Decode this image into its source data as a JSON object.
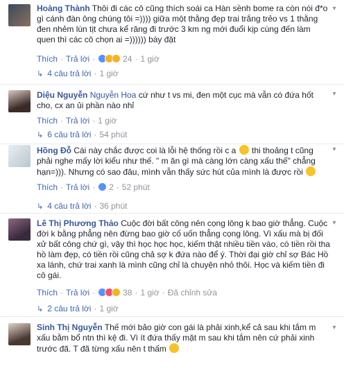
{
  "comments": [
    {
      "name": "Hoàng Thành",
      "text": " Thôi đi các cô cũng thích soái ca Hàn sềnh bome ra còn nói đ*o gì cánh đàn ông chúng tôi =)))) giữa một thằng đẹp trai trắng trẻo vs 1 thằng đen nhẻm lùn tịt chưa kể răng đi trước 3 km ng mới đuổi kịp cùng đến làm quen thì các cô chọn ai =)))))) bày đặt",
      "like": "Thích",
      "reply": "Trả lời",
      "reactions": "24",
      "time": "1 giờ",
      "reply_arrow": "↳",
      "replies_label": "4 câu trả lời",
      "replies_time": "1 giờ"
    },
    {
      "name": "Diệu Nguyễn",
      "tag": "Nguyễn Hoa",
      "text": " cứ như t vs mi, đen một cục mà vẫn có đứa hốt cho, cx an ủi phần nào nhỉ",
      "like": "Thích",
      "reply": "Trả lời",
      "time": "1 giờ",
      "reply_arrow": "↳",
      "replies_label": "6 câu trả lời",
      "replies_time": "54 phút"
    },
    {
      "name": "Hồng Đỗ",
      "text_1": " Cái này chắc được coi là lỗi hệ thống rồi c a ",
      "text_2": " thi thoảng t cũng phải nghe mấy lời kiểu như thế. \" m ăn gì mà càng lớn càng xấu thế\" chẳng hạn=))). Nhưng có sao đâu, mình vẫn thấy sức hút của mình là được rồi",
      "like": "Thích",
      "reply": "Trả lời",
      "reactions": "2",
      "time": "52 phút",
      "reply_arrow": "↳",
      "replies_label": "4 câu trả lời",
      "replies_time": "36 phút"
    },
    {
      "name": "Lê Thị Phương Thảo",
      "text": " Cuộc đời bất công nên cọng lông k bao giờ thẳng. Cuộc đời k bằng phẳng nên đừng bao giờ cố uốn thẳng cọng lông. Vì xấu mà bị đối xử bất công chứ gì, vậy thì học học học, kiếm thật nhiều tiền vào, có tiền rồi tha hồ làm đẹp, có tiền rồi cũng chả sợ k đứa nào để ý. Thời đại giờ chỉ sợ Bác Hồ xa lánh, chứ trai xanh là mình cũng chỉ là chuyện nhỏ thôi. Học và kiếm tiền đi cô gái.",
      "like": "Thích",
      "reply": "Trả lời",
      "reactions": "38",
      "time": "1 giờ",
      "edited": "Đã chỉnh sửa",
      "reply_arrow": "↳",
      "replies_label": "2 câu trả lời",
      "replies_time": "1 giờ"
    },
    {
      "name": "Sinh Thị Nguyễn",
      "text": " Thế mới bảo giờ con gái là phải xinh,kể cả sau khi tắm m xấu bằm bổ ntn thì kệ đi. Vì ít đứa thấy mặt m sau khi tắm nên cứ phải xinh trước đã. T đã từng xấu nên t thấm "
    }
  ],
  "colors": {
    "link": "#365899",
    "meta": "#90949c",
    "like_blue": "#5890ff",
    "haha_yellow": "#f7b125"
  },
  "icons": [
    "chevron-down-icon",
    "like-reaction-icon",
    "haha-reaction-icon",
    "sad-reaction-icon",
    "love-reaction-icon",
    "smile-emoji-icon",
    "reply-arrow-icon"
  ]
}
